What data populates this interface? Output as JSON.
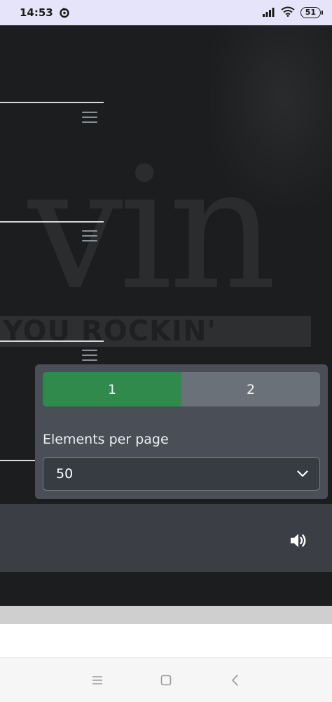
{
  "status_bar": {
    "time": "14:53",
    "battery": "51",
    "icons": [
      "sync-icon",
      "signal-icon",
      "wifi-icon",
      "battery-icon"
    ]
  },
  "background_art": {
    "big_text": "vin",
    "tagline": "YOU ROCKIN'"
  },
  "list": {
    "items": [
      {
        "icon": "menu-icon"
      },
      {
        "icon": "menu-icon"
      },
      {
        "icon": "menu-icon"
      }
    ]
  },
  "page_popup": {
    "pages": [
      {
        "label": "1",
        "active": true
      },
      {
        "label": "2",
        "active": false
      }
    ],
    "elements_label": "Elements per page",
    "elements_value": "50",
    "accent_color": "#2f8a4c"
  },
  "player_bar": {
    "icon": "volume-icon"
  },
  "nav_bar": {
    "buttons": [
      "menu-nav-icon",
      "home-nav-icon",
      "back-nav-icon"
    ]
  }
}
